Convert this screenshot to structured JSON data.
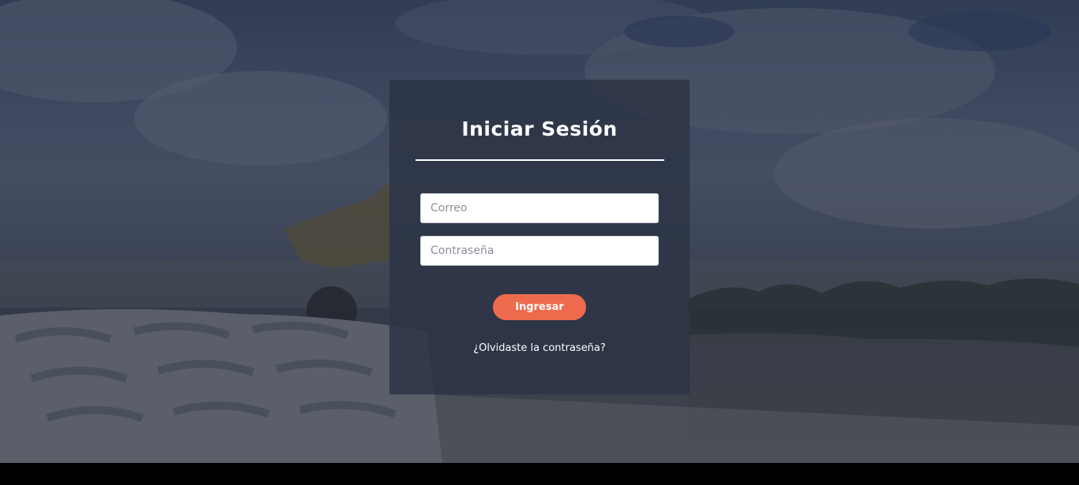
{
  "login": {
    "title": "Iniciar Sesión",
    "email": {
      "placeholder": "Correo",
      "value": ""
    },
    "password": {
      "placeholder": "Contraseña",
      "value": ""
    },
    "submit_label": "Ingresar",
    "forgot_link": "¿Olvidaste la contraseña?"
  },
  "colors": {
    "card_background": "#2c3446",
    "accent": "#ee6a4c",
    "text": "#ffffff"
  }
}
